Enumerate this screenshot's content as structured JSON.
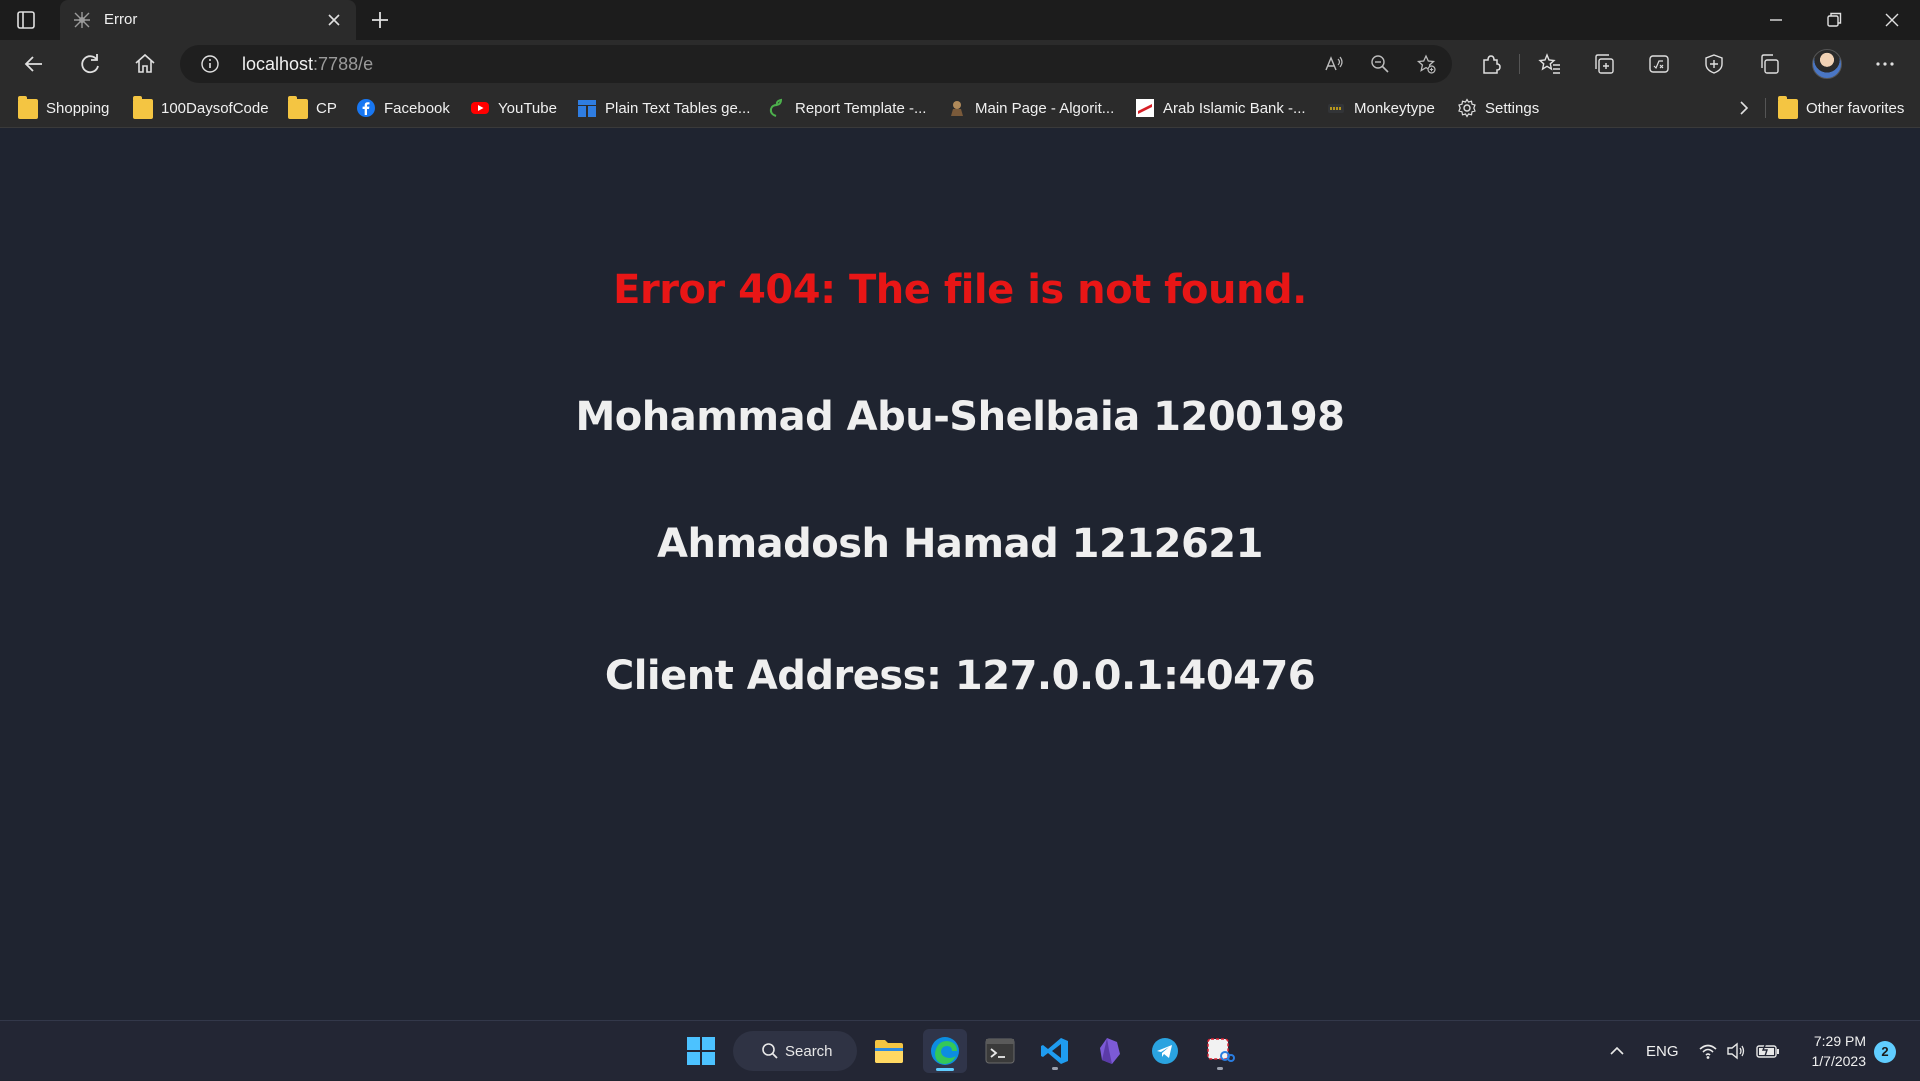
{
  "browser": {
    "tab": {
      "title": "Error"
    },
    "address_bar": {
      "host": "localhost",
      "path": ":7788/e"
    },
    "bookmarks": [
      {
        "label": "Shopping",
        "icon": "folder-icon"
      },
      {
        "label": "100DaysofCode",
        "icon": "folder-icon"
      },
      {
        "label": "CP",
        "icon": "folder-icon"
      },
      {
        "label": "Facebook",
        "icon": "facebook-icon"
      },
      {
        "label": "YouTube",
        "icon": "youtube-icon"
      },
      {
        "label": "Plain Text Tables ge...",
        "icon": "table-icon"
      },
      {
        "label": "Report Template -...",
        "icon": "overleaf-icon"
      },
      {
        "label": "Main Page - Algorit...",
        "icon": "algorithmica-icon"
      },
      {
        "label": "Arab Islamic Bank -...",
        "icon": "bank-icon"
      },
      {
        "label": "Monkeytype",
        "icon": "monkeytype-icon"
      },
      {
        "label": "Settings",
        "icon": "gear-icon"
      }
    ],
    "other_favorites": "Other favorites"
  },
  "page": {
    "error_message": "Error 404: The file is not found.",
    "author_1": "Mohammad Abu-Shelbaia 1200198",
    "author_2": "Ahmadosh Hamad 1212621",
    "client_address": "Client Address: 127.0.0.1:40476"
  },
  "taskbar": {
    "search_label": "Search",
    "language": "ENG",
    "time": "7:29 PM",
    "date": "1/7/2023",
    "notification_count": "2"
  },
  "colors": {
    "page_background": "#1f2430",
    "error_text": "#e81616",
    "body_text": "#efefef",
    "accent": "#60cdff"
  }
}
